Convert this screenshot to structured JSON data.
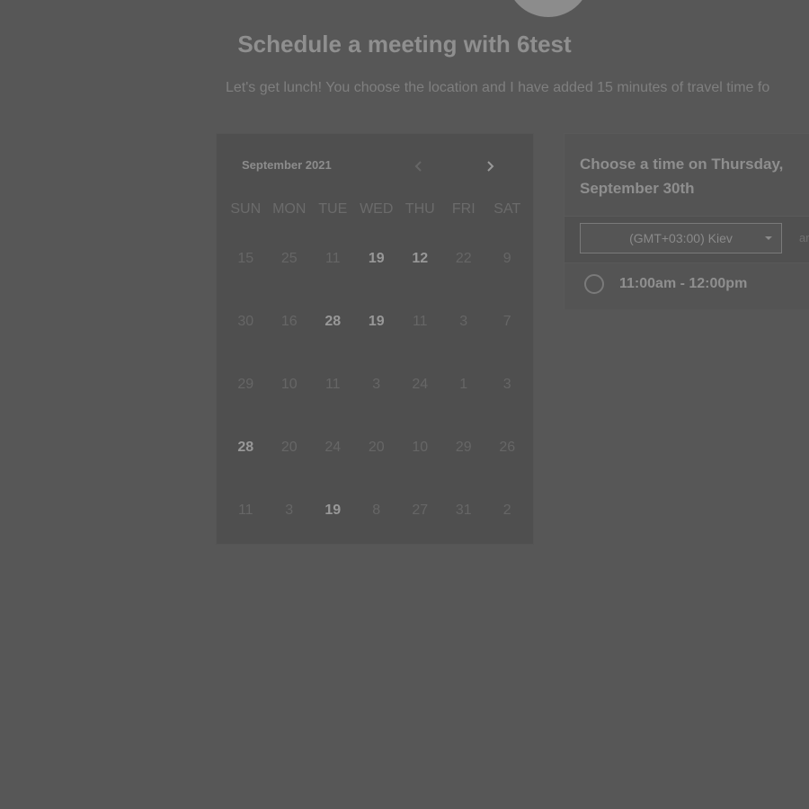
{
  "header": {
    "title": "Schedule a meeting with 6test",
    "subtitle": "Let's get lunch! You choose the location and I have added 15 minutes of travel time fo"
  },
  "calendar": {
    "month_label": "September 2021",
    "weekdays": [
      "SUN",
      "MON",
      "TUE",
      "WED",
      "THU",
      "FRI",
      "SAT"
    ],
    "weeks": [
      [
        {
          "d": "15",
          "a": false
        },
        {
          "d": "25",
          "a": false
        },
        {
          "d": "11",
          "a": false
        },
        {
          "d": "19",
          "a": true
        },
        {
          "d": "12",
          "a": true
        },
        {
          "d": "22",
          "a": false
        },
        {
          "d": "9",
          "a": false
        }
      ],
      [
        {
          "d": "30",
          "a": false
        },
        {
          "d": "16",
          "a": false
        },
        {
          "d": "28",
          "a": true
        },
        {
          "d": "19",
          "a": true
        },
        {
          "d": "11",
          "a": false
        },
        {
          "d": "3",
          "a": false
        },
        {
          "d": "7",
          "a": false
        }
      ],
      [
        {
          "d": "29",
          "a": false
        },
        {
          "d": "10",
          "a": false
        },
        {
          "d": "11",
          "a": false
        },
        {
          "d": "3",
          "a": false
        },
        {
          "d": "24",
          "a": false
        },
        {
          "d": "1",
          "a": false
        },
        {
          "d": "3",
          "a": false
        }
      ],
      [
        {
          "d": "28",
          "a": true
        },
        {
          "d": "20",
          "a": false
        },
        {
          "d": "24",
          "a": false
        },
        {
          "d": "20",
          "a": false
        },
        {
          "d": "10",
          "a": false
        },
        {
          "d": "29",
          "a": false
        },
        {
          "d": "26",
          "a": false
        }
      ],
      [
        {
          "d": "11",
          "a": false
        },
        {
          "d": "3",
          "a": false
        },
        {
          "d": "19",
          "a": true
        },
        {
          "d": "8",
          "a": false
        },
        {
          "d": "27",
          "a": false
        },
        {
          "d": "31",
          "a": false
        },
        {
          "d": "2",
          "a": false
        }
      ]
    ]
  },
  "time_panel": {
    "title": "Choose a time on Thursday, September 30th",
    "timezone": "(GMT+03:00) Kiev",
    "timezone_extra": "ar",
    "slots": [
      "11:00am - 12:00pm"
    ]
  },
  "icons": {
    "prev": "chevron-left-icon",
    "next": "chevron-right-icon",
    "caret": "caret-down-icon"
  },
  "colors": {
    "background": "#575757",
    "panel": "#505050"
  }
}
